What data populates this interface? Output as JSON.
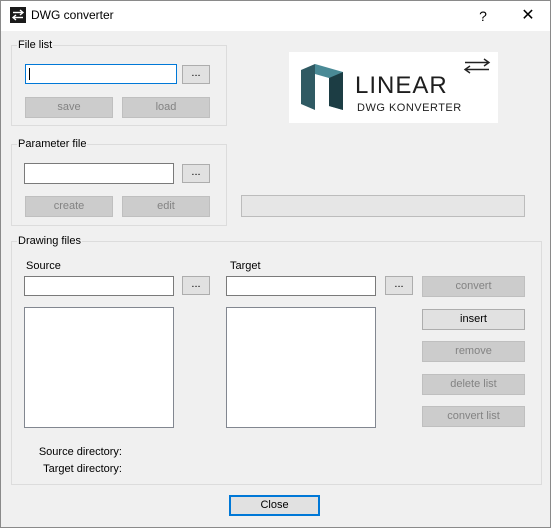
{
  "window": {
    "title": "DWG converter",
    "help_glyph": "?",
    "close_glyph": "✕"
  },
  "logo": {
    "word": "LINEAR",
    "subtitle": "DWG KONVERTER",
    "mark_colors": [
      "#2f5a63",
      "#4a8a96",
      "#1c3d44"
    ]
  },
  "file_list": {
    "legend": "File list",
    "value": "",
    "browse": "...",
    "save": "save",
    "load": "load"
  },
  "parameter_file": {
    "legend": "Parameter file",
    "value": "",
    "browse": "...",
    "create": "create",
    "edit": "edit"
  },
  "progress": 0,
  "drawing_files": {
    "legend": "Drawing files",
    "source_label": "Source",
    "source_value": "",
    "source_browse": "...",
    "target_label": "Target",
    "target_value": "",
    "target_browse": "...",
    "convert": "convert",
    "insert": "insert",
    "remove": "remove",
    "delete_list": "delete list",
    "convert_list": "convert list",
    "source_directory_label": "Source directory:",
    "target_directory_label": "Target directory:"
  },
  "close_button": "Close"
}
